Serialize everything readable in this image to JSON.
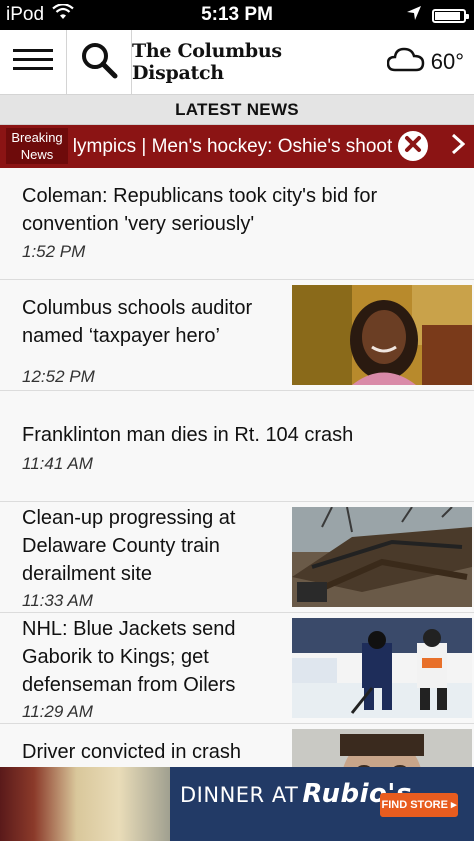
{
  "status_bar": {
    "carrier": "iPod",
    "time": "5:13 PM",
    "battery_level": 0.9
  },
  "header": {
    "logo_text": "The Columbus Dispatch",
    "weather_temp": "60°",
    "weather_icon": "cloud-icon"
  },
  "section": {
    "title": "LATEST NEWS"
  },
  "breaking": {
    "label_line1": "Breaking",
    "label_line2": "News",
    "ticker_text": "Olympics | Men's hockey: Oshie's shootout"
  },
  "stories": [
    {
      "headline": "Coleman: Republicans took city's bid for convention 'very seriously'",
      "time": "1:52 PM",
      "has_image": false
    },
    {
      "headline": "Columbus schools auditor named ‘taxpayer hero’",
      "time": "12:52 PM",
      "has_image": true,
      "image": "portrait-photo"
    },
    {
      "headline": "Franklinton man dies in Rt. 104 crash",
      "time": "11:41 AM",
      "has_image": false
    },
    {
      "headline": "Clean-up progressing at Delaware County train derailment site",
      "time": "11:33 AM",
      "has_image": true,
      "image": "derailment-photo"
    },
    {
      "headline": "NHL: Blue Jackets send Gaborik to Kings; get defenseman from Oilers",
      "time": "11:29 AM",
      "has_image": true,
      "image": "hockey-photo"
    },
    {
      "headline": "Driver convicted in crash",
      "time": "",
      "has_image": true,
      "image": "mugshot-photo"
    }
  ],
  "ad": {
    "text": "DINNER AT",
    "brand": "Rubio's",
    "cta": "FIND STORE ▸"
  },
  "colors": {
    "breaking_bg": "#8b1414",
    "list_bg": "#f8f8f8",
    "section_bar_bg": "#e4e4e4"
  }
}
